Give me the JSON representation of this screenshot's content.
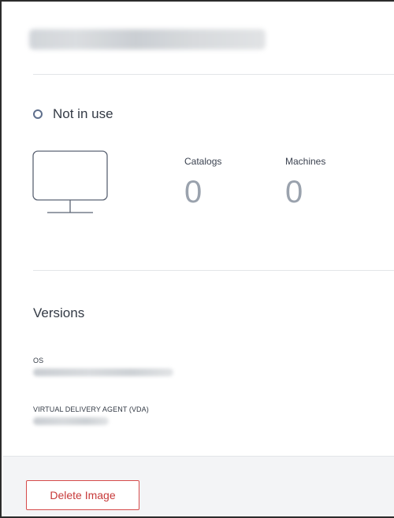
{
  "status": {
    "text": "Not in use",
    "icon": "hollow-circle-icon",
    "color": "#5f6f8c"
  },
  "image_icon": "monitor-icon",
  "stats": {
    "catalogs": {
      "label": "Catalogs",
      "value": "0"
    },
    "machines": {
      "label": "Machines",
      "value": "0"
    }
  },
  "versions": {
    "title": "Versions",
    "os_label": "OS",
    "vda_label": "VIRTUAL DELIVERY AGENT (VDA)"
  },
  "footer": {
    "delete_label": "Delete Image",
    "delete_color": "#c73a3a"
  }
}
